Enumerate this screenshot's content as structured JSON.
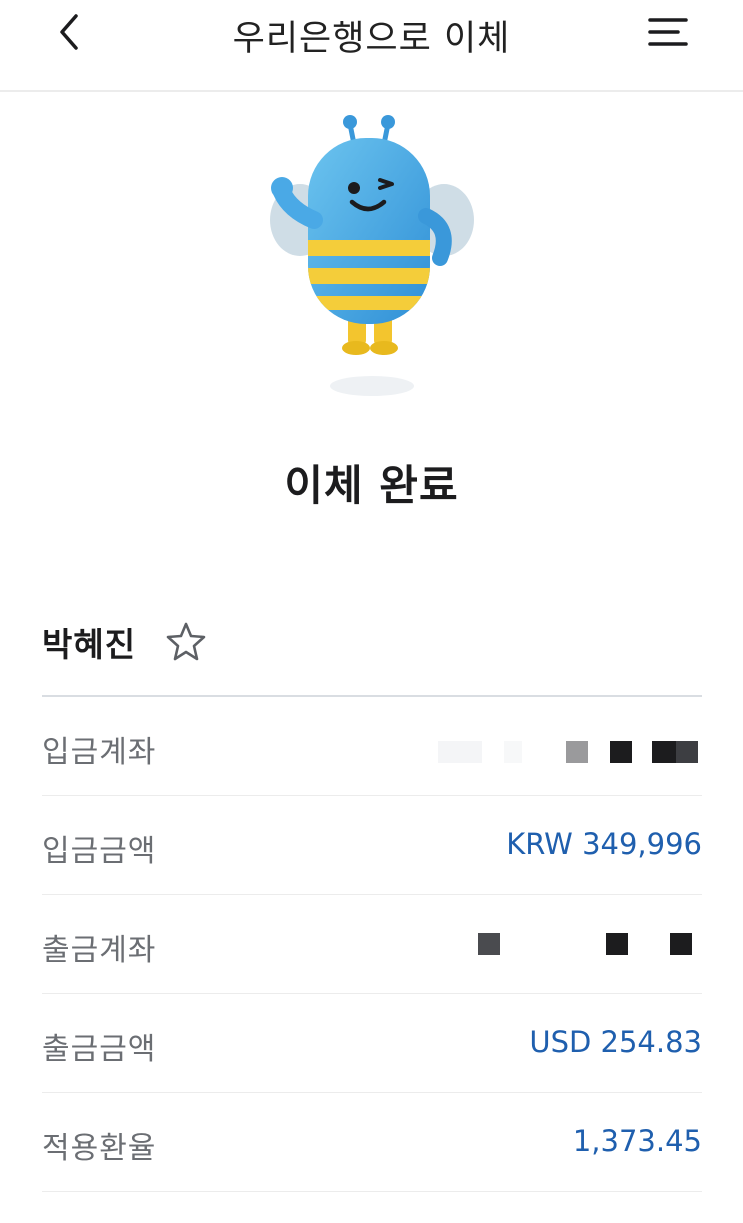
{
  "header": {
    "title": "우리은행으로 이체"
  },
  "result": {
    "title": "이체 완료"
  },
  "recipient": {
    "name": "박혜진"
  },
  "details": [
    {
      "label": "입금계좌",
      "masked": true
    },
    {
      "label": "입금금액",
      "value": "KRW 349,996"
    },
    {
      "label": "출금계좌",
      "masked": true
    },
    {
      "label": "출금금액",
      "value": "USD 254.83"
    },
    {
      "label": "적용환율",
      "value": "1,373.45"
    }
  ],
  "icons": {
    "back": "chevron-left-icon",
    "menu": "hamburger-menu-icon",
    "favorite": "star-outline-icon",
    "mascot": "bee-mascot-illustration"
  },
  "colors": {
    "accent": "#1f5fae",
    "label": "#6b6e73",
    "title": "#1c1c1e",
    "divider": "#d9dde2"
  }
}
